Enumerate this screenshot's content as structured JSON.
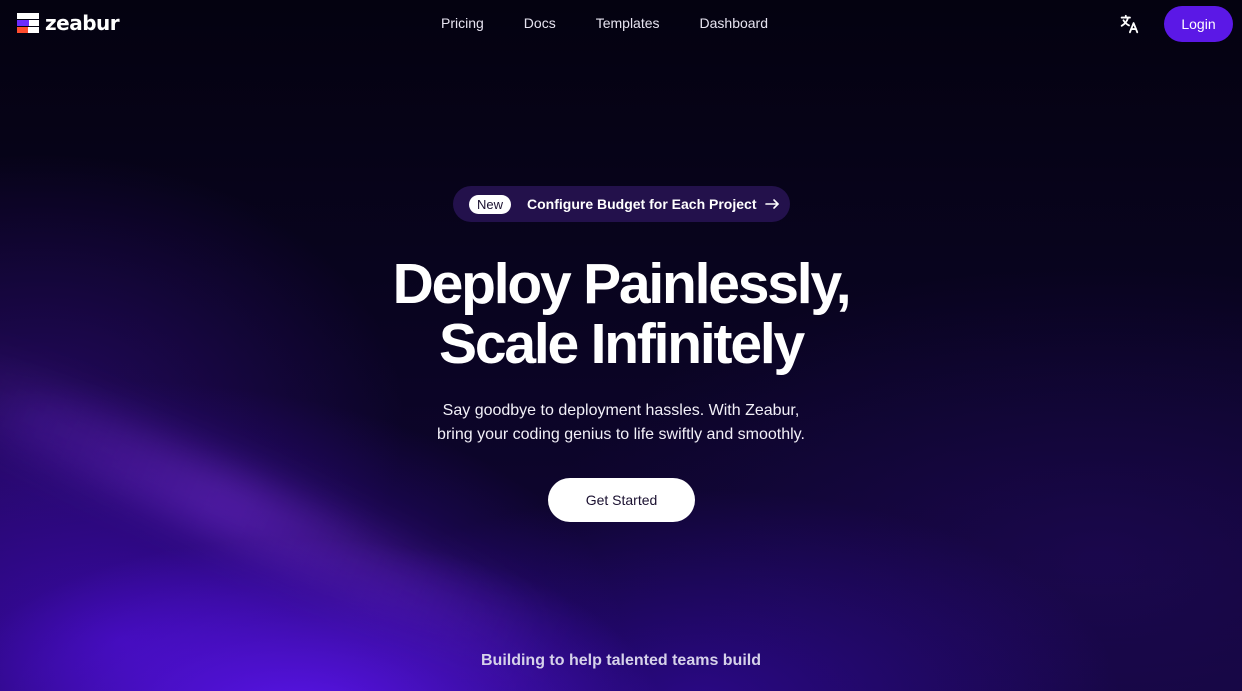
{
  "header": {
    "logo_text": "zeabur",
    "nav": [
      {
        "label": "Pricing"
      },
      {
        "label": "Docs"
      },
      {
        "label": "Templates"
      },
      {
        "label": "Dashboard"
      }
    ],
    "language_icon": "translate-icon",
    "login_label": "Login"
  },
  "announcement": {
    "badge": "New",
    "text": "Configure Budget for Each Project",
    "arrow_icon": "arrow-right-icon"
  },
  "hero": {
    "title_line1": "Deploy Painlessly,",
    "title_line2": "Scale Infinitely",
    "subtitle_line1": "Say goodbye to deployment hassles. With Zeabur,",
    "subtitle_line2": "bring your coding genius to life swiftly and smoothly.",
    "cta_label": "Get Started"
  },
  "building_text": "Building to help talented teams build",
  "colors": {
    "accent": "#5b18e6",
    "background": "#05030f",
    "logo_purple": "#6b2dff",
    "logo_orange": "#ff4d2e"
  }
}
